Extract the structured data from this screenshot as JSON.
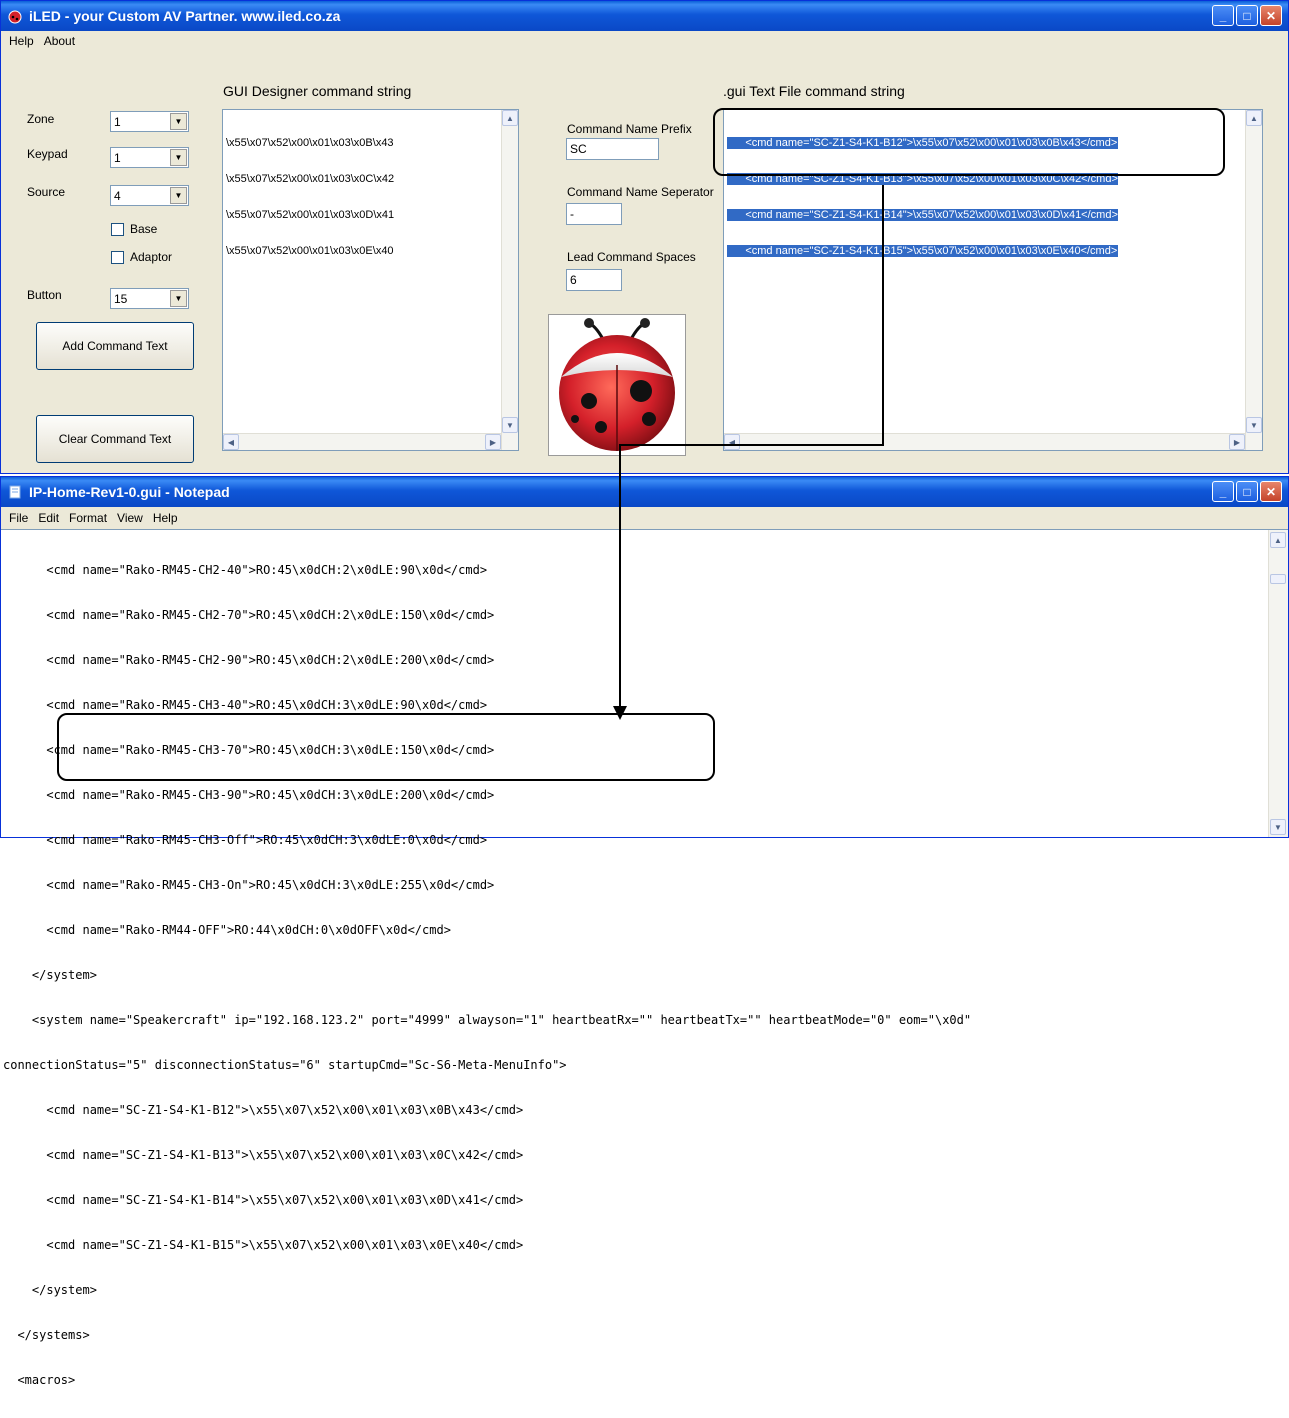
{
  "iled_window": {
    "title": "iLED - your Custom AV Partner.    www.iled.co.za",
    "menu": [
      "Help",
      "About"
    ],
    "labels": {
      "zone": "Zone",
      "keypad": "Keypad",
      "source": "Source",
      "button": "Button",
      "base": "Base",
      "adaptor": "Adaptor",
      "gui_designer": "GUI Designer command string",
      "gui_textfile": ".gui Text File command string",
      "prefix": "Command Name Prefix",
      "separator": "Command Name Seperator",
      "lead_spaces": "Lead Command Spaces"
    },
    "combos": {
      "zone": "1",
      "keypad": "1",
      "source": "4",
      "button": "15"
    },
    "inputs": {
      "prefix": "SC",
      "separator": "-",
      "lead_spaces": "6"
    },
    "buttons": {
      "add": "Add Command Text",
      "clear": "Clear Command Text"
    },
    "designer_lines": [
      "\\x55\\x07\\x52\\x00\\x01\\x03\\x0B\\x43",
      "\\x55\\x07\\x52\\x00\\x01\\x03\\x0C\\x42",
      "\\x55\\x07\\x52\\x00\\x01\\x03\\x0D\\x41",
      "\\x55\\x07\\x52\\x00\\x01\\x03\\x0E\\x40"
    ],
    "gui_lines": [
      "      <cmd name=\"SC-Z1-S4-K1-B12\">\\x55\\x07\\x52\\x00\\x01\\x03\\x0B\\x43</cmd>",
      "      <cmd name=\"SC-Z1-S4-K1-B13\">\\x55\\x07\\x52\\x00\\x01\\x03\\x0C\\x42</cmd>",
      "      <cmd name=\"SC-Z1-S4-K1-B14\">\\x55\\x07\\x52\\x00\\x01\\x03\\x0D\\x41</cmd>",
      "      <cmd name=\"SC-Z1-S4-K1-B15\">\\x55\\x07\\x52\\x00\\x01\\x03\\x0E\\x40</cmd>"
    ]
  },
  "notepad_window": {
    "title": "IP-Home-Rev1-0.gui - Notepad",
    "menu": [
      "File",
      "Edit",
      "Format",
      "View",
      "Help"
    ],
    "lines": [
      "      <cmd name=\"Rako-RM45-CH2-40\">RO:45\\x0dCH:2\\x0dLE:90\\x0d</cmd>",
      "      <cmd name=\"Rako-RM45-CH2-70\">RO:45\\x0dCH:2\\x0dLE:150\\x0d</cmd>",
      "      <cmd name=\"Rako-RM45-CH2-90\">RO:45\\x0dCH:2\\x0dLE:200\\x0d</cmd>",
      "      <cmd name=\"Rako-RM45-CH3-40\">RO:45\\x0dCH:3\\x0dLE:90\\x0d</cmd>",
      "      <cmd name=\"Rako-RM45-CH3-70\">RO:45\\x0dCH:3\\x0dLE:150\\x0d</cmd>",
      "      <cmd name=\"Rako-RM45-CH3-90\">RO:45\\x0dCH:3\\x0dLE:200\\x0d</cmd>",
      "      <cmd name=\"Rako-RM45-CH3-Off\">RO:45\\x0dCH:3\\x0dLE:0\\x0d</cmd>",
      "      <cmd name=\"Rako-RM45-CH3-On\">RO:45\\x0dCH:3\\x0dLE:255\\x0d</cmd>",
      "      <cmd name=\"Rako-RM44-OFF\">RO:44\\x0dCH:0\\x0dOFF\\x0d</cmd>",
      "    </system>",
      "    <system name=\"Speakercraft\" ip=\"192.168.123.2\" port=\"4999\" alwayson=\"1\" heartbeatRx=\"\" heartbeatTx=\"\" heartbeatMode=\"0\" eom=\"\\x0d\"",
      "connectionStatus=\"5\" disconnectionStatus=\"6\" startupCmd=\"Sc-S6-Meta-MenuInfo\">",
      "      <cmd name=\"SC-Z1-S4-K1-B12\">\\x55\\x07\\x52\\x00\\x01\\x03\\x0B\\x43</cmd>",
      "      <cmd name=\"SC-Z1-S4-K1-B13\">\\x55\\x07\\x52\\x00\\x01\\x03\\x0C\\x42</cmd>",
      "      <cmd name=\"SC-Z1-S4-K1-B14\">\\x55\\x07\\x52\\x00\\x01\\x03\\x0D\\x41</cmd>",
      "      <cmd name=\"SC-Z1-S4-K1-B15\">\\x55\\x07\\x52\\x00\\x01\\x03\\x0E\\x40</cmd>",
      "    </system>",
      "  </systems>",
      "  <macros>"
    ]
  },
  "colors": {
    "titlebar": "#0a5fd8",
    "window_bg": "#ece9d8",
    "selection": "#316ac5"
  }
}
